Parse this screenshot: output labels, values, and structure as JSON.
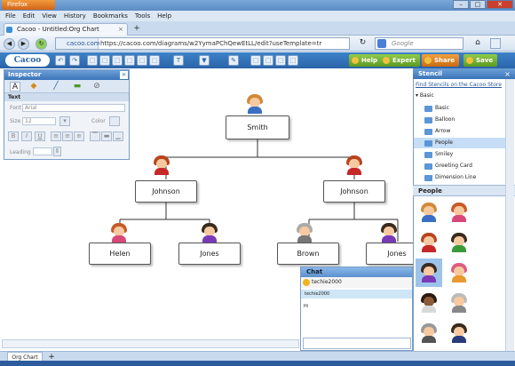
{
  "window": {
    "app_button": "Firefox",
    "controls": [
      "–",
      "□",
      "✕"
    ]
  },
  "menu": [
    "File",
    "Edit",
    "View",
    "History",
    "Bookmarks",
    "Tools",
    "Help"
  ],
  "tab": {
    "title": "Cacoo - Untitled:Org Chart",
    "close": "×",
    "new": "+"
  },
  "nav": {
    "site": "cacoo.com",
    "url": "https://cacoo.com/diagrams/w2YymaPChQewEtLL/edit?useTemplate=tr",
    "search_placeholder": "Google",
    "back": "◀",
    "forward": "▶",
    "reload": "↻",
    "home": "⌂"
  },
  "toolbar": {
    "logo": "Cacoo",
    "help": "Help",
    "expert": "Expert",
    "share": "Share",
    "save": "Save",
    "tools": [
      "↶",
      "↷",
      "⬚",
      "⬚",
      "⬚",
      "⬚",
      "⬚",
      "⬚",
      "T",
      "▼",
      "✎",
      "⬚",
      "⬚",
      "⬚",
      "⬚"
    ]
  },
  "inspector": {
    "title": "Inspector",
    "tabs": [
      "A",
      "◆",
      "╱",
      "▬",
      "⊘"
    ],
    "section": "Text",
    "font_label": "Font",
    "font_value": "Arial",
    "size_label": "Size",
    "size_value": "12",
    "color_label": "Color",
    "leading_label": "Leading",
    "format_buttons": [
      "B",
      "I",
      "U"
    ]
  },
  "org": {
    "root": "Smith",
    "level1": [
      "Johnson",
      "Johnson"
    ],
    "level2": [
      "Helen",
      "Jones",
      "Brown",
      "Jones"
    ]
  },
  "stencil": {
    "title": "Stencil",
    "find_link": "Find Stencils on the Cacoo Store",
    "group": "Basic",
    "items": [
      "Basic",
      "Balloon",
      "Arrow",
      "People",
      "Smiley",
      "Greeting Card",
      "Dimension Line"
    ],
    "selected": "People",
    "people_header": "People"
  },
  "chat": {
    "title": "Chat",
    "user": "techie2000",
    "message_author": "techie2000",
    "message": "Hi"
  },
  "pages": {
    "current": "Org Chart",
    "add": "+"
  },
  "colors": {
    "accent": "#2a64a8",
    "button_green": "#5c9a22",
    "selection": "#c6ddf5"
  }
}
